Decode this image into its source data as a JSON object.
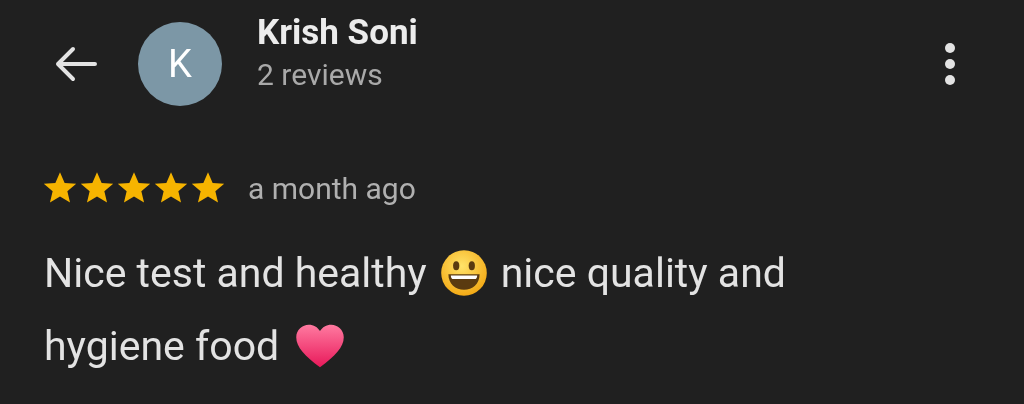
{
  "header": {
    "avatar_letter": "K",
    "name": "Krish Soni",
    "subtitle": "2 reviews"
  },
  "review": {
    "stars": 5,
    "time": "a month ago",
    "lines": [
      [
        {
          "kind": "text",
          "text": "Nice test and healthy"
        },
        {
          "kind": "grin"
        },
        {
          "kind": "text",
          "text": "nice quality and"
        }
      ],
      [
        {
          "kind": "text",
          "text": "hygiene food"
        },
        {
          "kind": "heart"
        }
      ]
    ]
  }
}
